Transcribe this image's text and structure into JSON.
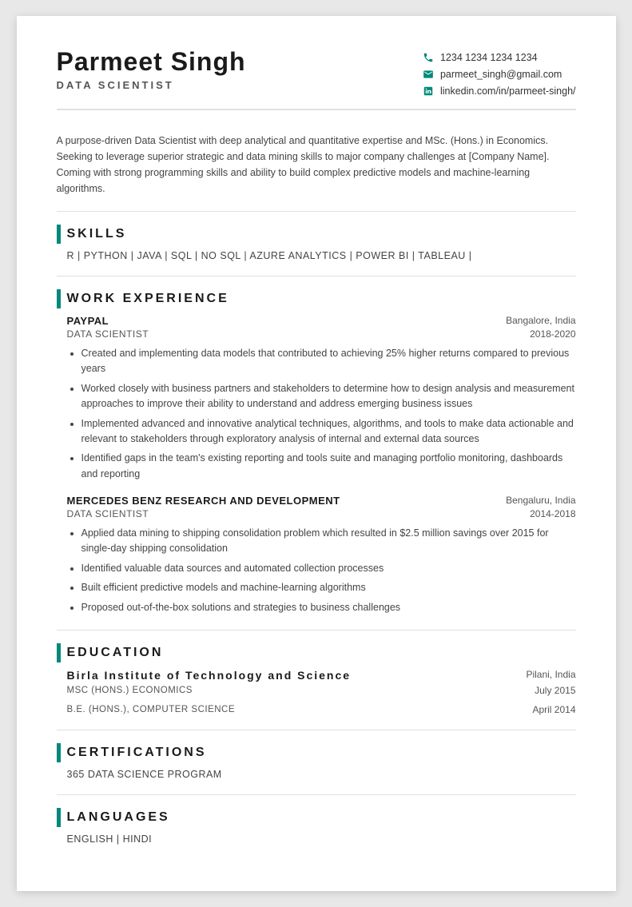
{
  "header": {
    "name": "Parmeet Singh",
    "title": "DATA SCIENTIST",
    "contact": {
      "phone": "1234 1234 1234 1234",
      "email": "parmeet_singh@gmail.com",
      "linkedin": "linkedin.com/in/parmeet-singh/"
    }
  },
  "summary": {
    "text": "A purpose-driven Data Scientist with deep analytical and quantitative expertise and MSc. (Hons.) in Economics. Seeking to leverage superior strategic and data mining skills to major company challenges at [Company Name]. Coming with strong programming skills and ability to build complex predictive models and machine-learning algorithms."
  },
  "skills": {
    "section_title": "SKILLS",
    "list": "R | PYTHON | JAVA | SQL | NO SQL | AZURE ANALYTICS | POWER BI | TABLEAU |"
  },
  "work_experience": {
    "section_title": "WORK EXPERIENCE",
    "jobs": [
      {
        "company": "PAYPAL",
        "location": "Bangalore, India",
        "job_title": "DATA SCIENTIST",
        "dates": "2018-2020",
        "bullets": [
          "Created and implementing data models that contributed to achieving 25% higher returns compared to previous years",
          "Worked closely with business partners and stakeholders to determine how to design analysis and measurement approaches to improve their ability to understand and address emerging business issues",
          "Implemented advanced and innovative analytical techniques, algorithms, and tools to make data actionable and relevant to stakeholders through exploratory analysis of internal and external data sources",
          "Identified gaps in the team's existing reporting and tools suite and managing portfolio monitoring, dashboards and reporting"
        ]
      },
      {
        "company": "MERCEDES BENZ RESEARCH AND DEVELOPMENT",
        "location": "Bengaluru, India",
        "job_title": "DATA SCIENTIST",
        "dates": "2014-2018",
        "bullets": [
          "Applied data mining to shipping consolidation problem which resulted in $2.5 million savings over 2015 for single-day shipping consolidation",
          "Identified valuable data sources and automated collection processes",
          "Built efficient predictive models and machine-learning algorithms",
          "Proposed out-of-the-box solutions and strategies to business challenges"
        ]
      }
    ]
  },
  "education": {
    "section_title": "EDUCATION",
    "institution": "Birla Institute of Technology and Science",
    "location": "Pilani, India",
    "degrees": [
      {
        "name": "MSC (HONS.) ECONOMICS",
        "date": "July 2015"
      },
      {
        "name": "B.E. (HONS.), COMPUTER SCIENCE",
        "date": "April 2014"
      }
    ]
  },
  "certifications": {
    "section_title": "CERTIFICATIONS",
    "items": [
      "365 DATA SCIENCE PROGRAM"
    ]
  },
  "languages": {
    "section_title": "LANGUAGES",
    "list": "ENGLISH | HINDI"
  }
}
